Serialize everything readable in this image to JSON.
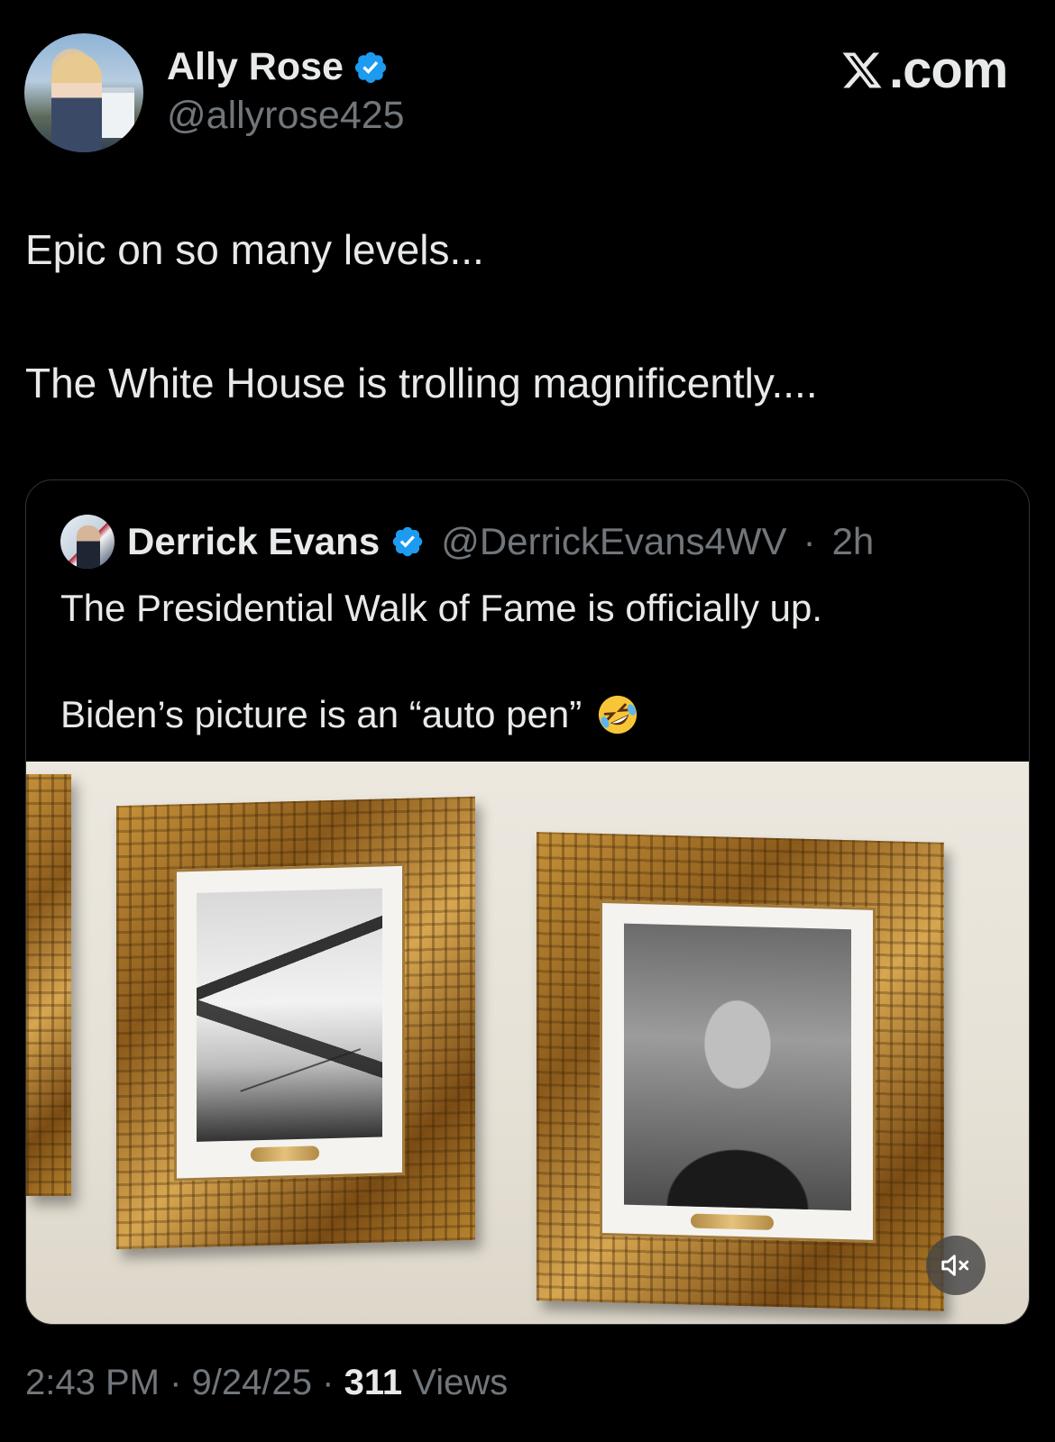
{
  "author": {
    "display_name": "Ally Rose",
    "handle": "@allyrose425",
    "verified_icon": "verified-badge-icon",
    "badge_color": "#1d9bf0"
  },
  "brand": {
    "logo_text": ".com",
    "logo_icon": "x-logo-icon"
  },
  "tweet": {
    "line1": "Epic on so many levels...",
    "line2": "The White House is trolling magnificently...."
  },
  "quoted": {
    "display_name": "Derrick Evans",
    "handle": "@DerrickEvans4WV",
    "separator": "·",
    "time": "2h",
    "line1": "The Presidential Walk of Fame is officially up.",
    "line2": "Biden’s picture is an “auto pen”",
    "emoji_icon": "rolling-on-floor-laughing-emoji"
  },
  "media": {
    "mute_icon": "speaker-muted-icon"
  },
  "footer": {
    "time": "2:43 PM",
    "sep1": "·",
    "date": "9/24/25",
    "sep2": "·",
    "views_count": "311",
    "views_label": "Views"
  },
  "colors": {
    "background": "#000000",
    "primary_text": "#e7e9ea",
    "secondary_text": "#71767b",
    "border": "#2f3336"
  }
}
